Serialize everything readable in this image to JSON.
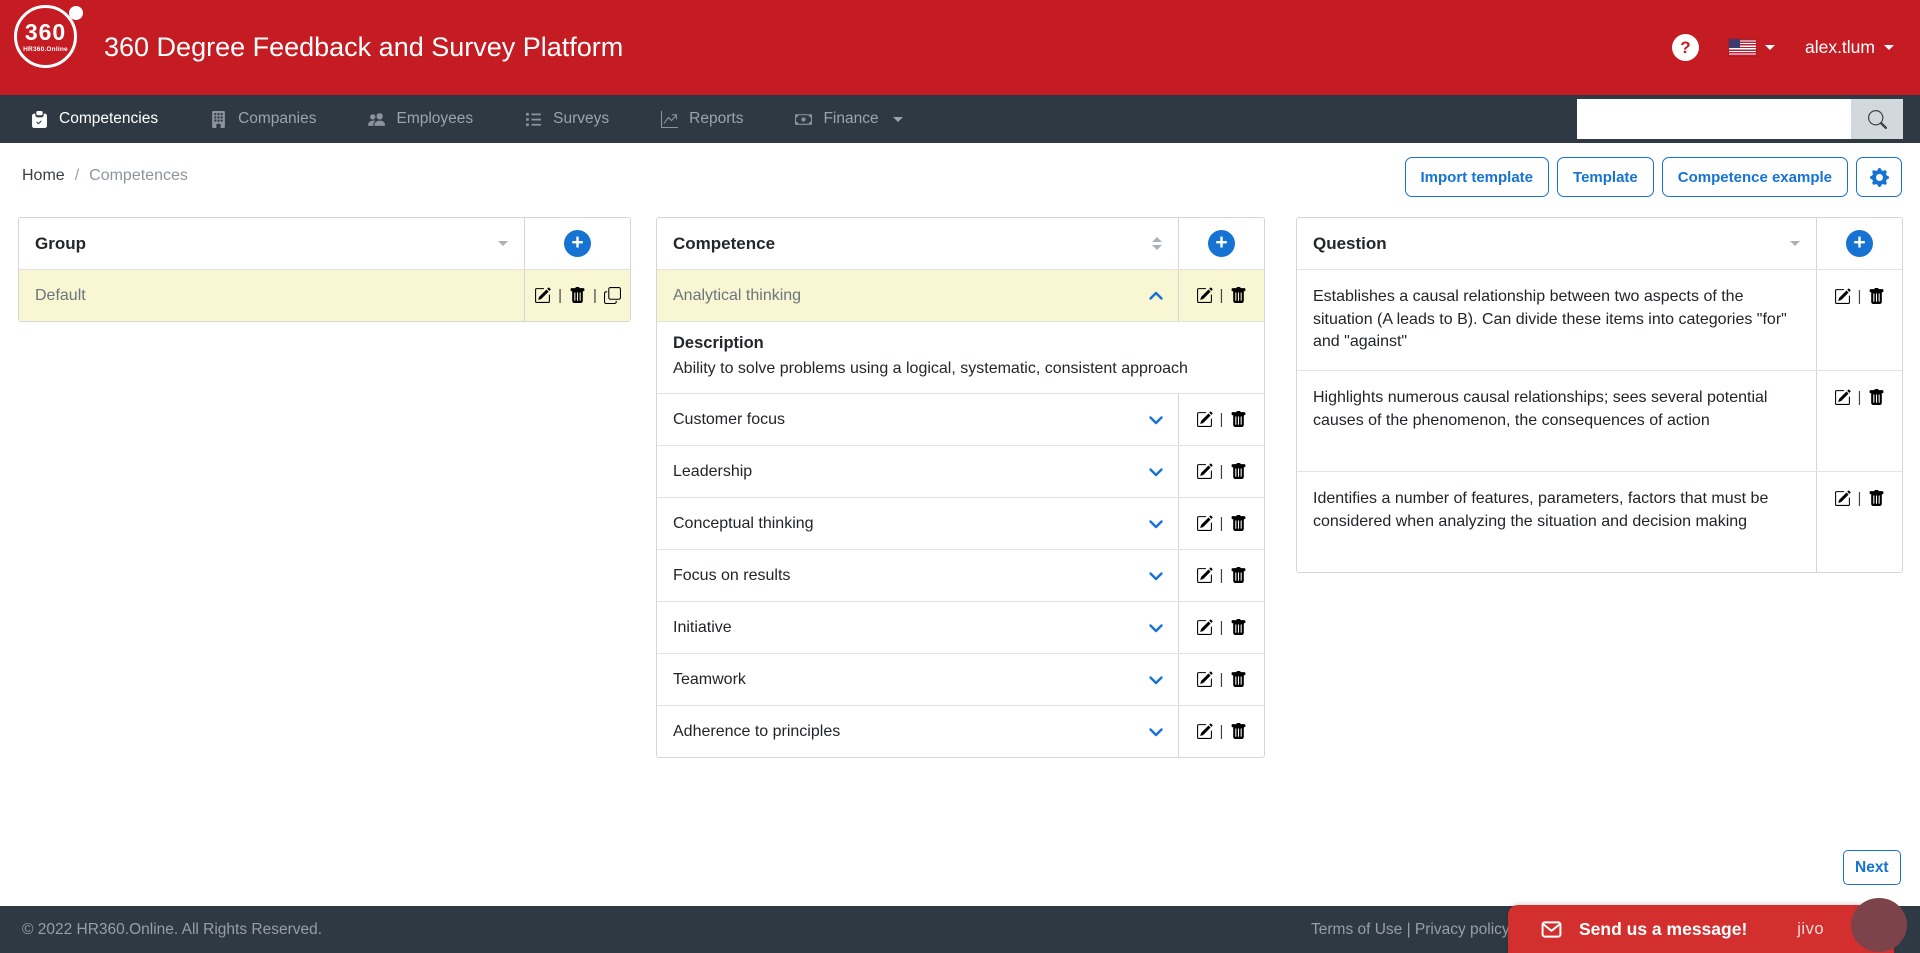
{
  "header": {
    "logo_text": "360",
    "logo_subtext": "HR360.Online",
    "app_title": "360 Degree Feedback and Survey Platform",
    "help_label": "?",
    "username": "alex.tlum"
  },
  "nav": {
    "items": [
      {
        "label": "Competencies"
      },
      {
        "label": "Companies"
      },
      {
        "label": "Employees"
      },
      {
        "label": "Surveys"
      },
      {
        "label": "Reports"
      },
      {
        "label": "Finance"
      }
    ],
    "search_value": "",
    "search_placeholder": ""
  },
  "breadcrumb": {
    "home": "Home",
    "separator": "/",
    "current": "Competences"
  },
  "toolbar": {
    "import_template": "Import template",
    "template": "Template",
    "competence_example": "Competence example"
  },
  "group_panel": {
    "title": "Group",
    "rows": [
      {
        "label": "Default"
      }
    ]
  },
  "competence_panel": {
    "title": "Competence",
    "rows": [
      {
        "label": "Analytical thinking"
      },
      {
        "label": "Customer focus"
      },
      {
        "label": "Leadership"
      },
      {
        "label": "Conceptual thinking"
      },
      {
        "label": "Focus on results"
      },
      {
        "label": "Initiative"
      },
      {
        "label": "Teamwork"
      },
      {
        "label": "Adherence to principles"
      }
    ],
    "description_title": "Description",
    "description_text": "Ability to solve problems using a logical, systematic, consistent approach"
  },
  "question_panel": {
    "title": "Question",
    "rows": [
      {
        "text": "Establishes a causal relationship between two aspects of the situation (A leads to B). Can divide these items into categories \"for\" and \"against\""
      },
      {
        "text": "Highlights numerous causal relationships; sees several potential causes of the phenomenon, the consequences of action"
      },
      {
        "text": "Identifies a number of features, parameters, factors that must be considered when analyzing the situation and decision making"
      }
    ]
  },
  "pagination": {
    "next": "Next"
  },
  "footer": {
    "copyright": "© 2022 HR360.Online. All Rights Reserved.",
    "links": "Terms of Use | Privacy policy"
  },
  "chat": {
    "message": "Send us a message!",
    "brand": "jivo"
  },
  "ui": {
    "separator": "|",
    "colors": {
      "header_red": "#c41c22",
      "chat_red": "#d32f2f",
      "nav_dark": "#2f3943",
      "accent_blue": "#1673d2",
      "selected_yellow": "#f8f6d3"
    }
  }
}
